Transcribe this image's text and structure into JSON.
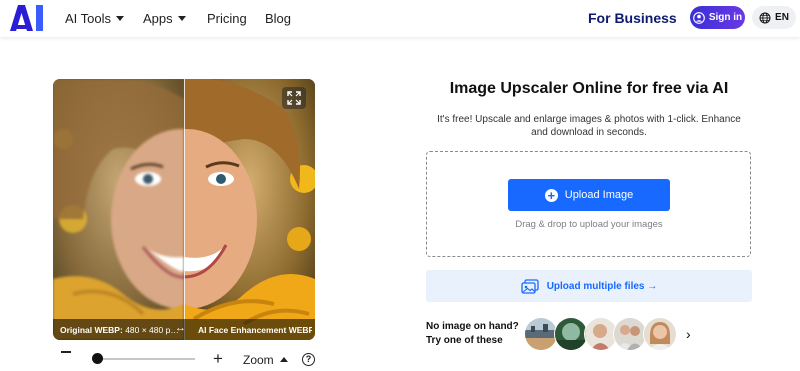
{
  "header": {
    "nav": [
      {
        "label": "AI Tools",
        "has_dropdown": true
      },
      {
        "label": "Apps",
        "has_dropdown": true
      },
      {
        "label": "Pricing",
        "has_dropdown": false
      },
      {
        "label": "Blog",
        "has_dropdown": false
      }
    ],
    "for_business": "For Business",
    "signin_label": "Sign in",
    "language": "EN",
    "logo_icon": "ai-logo-icon"
  },
  "preview": {
    "caption_left_label": "Original WEBP:",
    "caption_left_size": "480 × 480 p…",
    "caption_mid": "↔",
    "caption_right": "AI Face Enhancement WEBP",
    "expand_icon": "expand-icon"
  },
  "zoom": {
    "label": "Zoom",
    "value_fraction": 0.04
  },
  "main": {
    "title": "Image Upscaler Online for free via AI",
    "description": "It's free! Upscale and enlarge images & photos with 1-click. Enhance and download in seconds.",
    "upload_button": "Upload Image",
    "drag_text": "Drag & drop to upload your images",
    "multi_upload": "Upload multiple files →",
    "no_image_line1": "No image on hand?",
    "no_image_line2": "Try one of these"
  },
  "colors": {
    "accent": "#1769ff",
    "brand_dark": "#0d1b6e",
    "signin_gradient_start": "#3a2fd6",
    "signin_gradient_end": "#6a39e6",
    "multi_upload_bg": "#e9f1fd"
  },
  "samples": [
    {
      "name": "sample-landscape-city"
    },
    {
      "name": "sample-landscape-nature"
    },
    {
      "name": "sample-portrait-child"
    },
    {
      "name": "sample-portrait-family"
    },
    {
      "name": "sample-portrait-woman"
    }
  ]
}
